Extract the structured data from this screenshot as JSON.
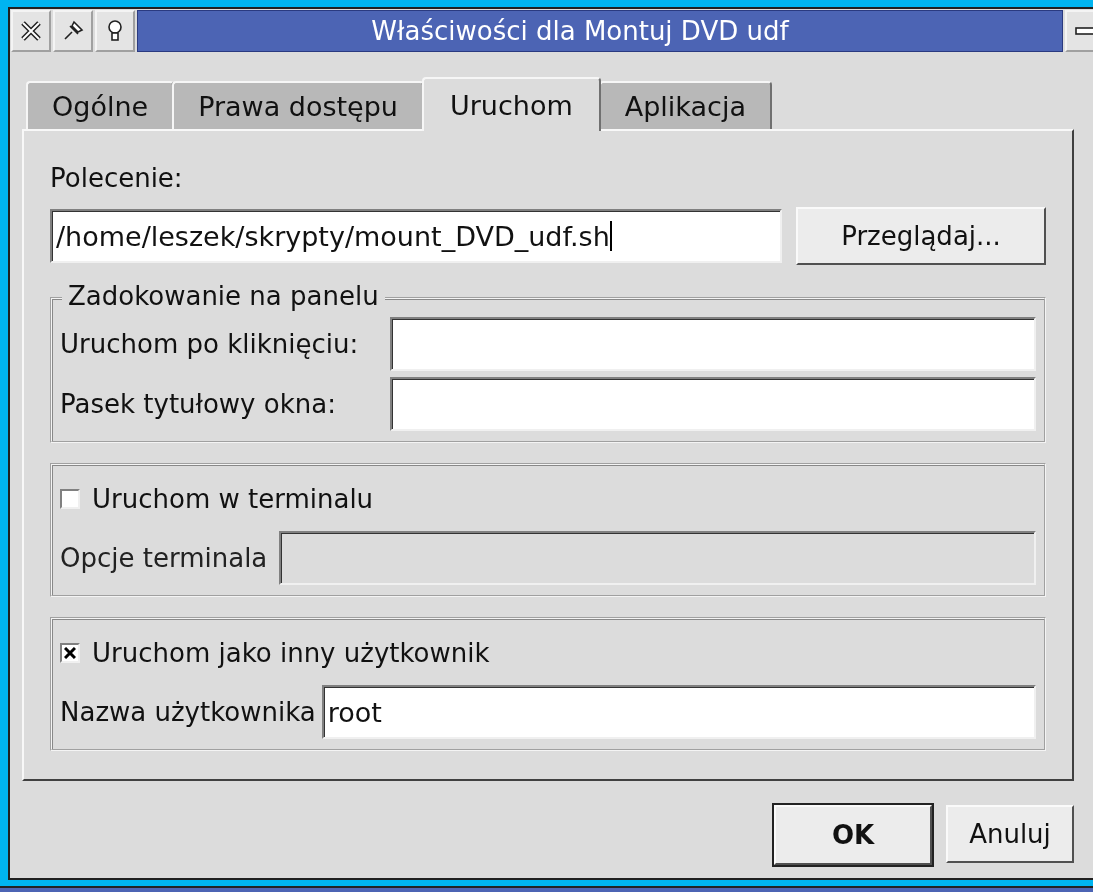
{
  "window": {
    "title": "Właściwości dla Montuj DVD udf"
  },
  "tabs": [
    {
      "label": "Ogólne",
      "selected": false
    },
    {
      "label": "Prawa dostępu",
      "selected": false
    },
    {
      "label": "Uruchom",
      "selected": true
    },
    {
      "label": "Aplikacja",
      "selected": false
    }
  ],
  "command": {
    "label": "Polecenie:",
    "value": "/home/leszek/skrypty/mount_DVD_udf.sh",
    "browse_button": "Przeglądaj..."
  },
  "docking": {
    "title": "Zadokowanie na panelu",
    "fields": [
      {
        "label": "Uruchom po kliknięciu:"
      },
      {
        "label": "Pasek tytułowy okna:"
      }
    ]
  },
  "terminal": {
    "checkbox": "Uruchom w terminalu",
    "checked": false,
    "field_label": "Opcje terminala"
  },
  "other_user": {
    "checkbox": "Uruchom jako inny użytkownik",
    "checked": true,
    "field_label": "Nazwa użytkownika",
    "value": "root"
  },
  "buttons": [
    {
      "label": "OK",
      "default": true
    },
    {
      "label": "Anuluj",
      "default": false
    }
  ]
}
